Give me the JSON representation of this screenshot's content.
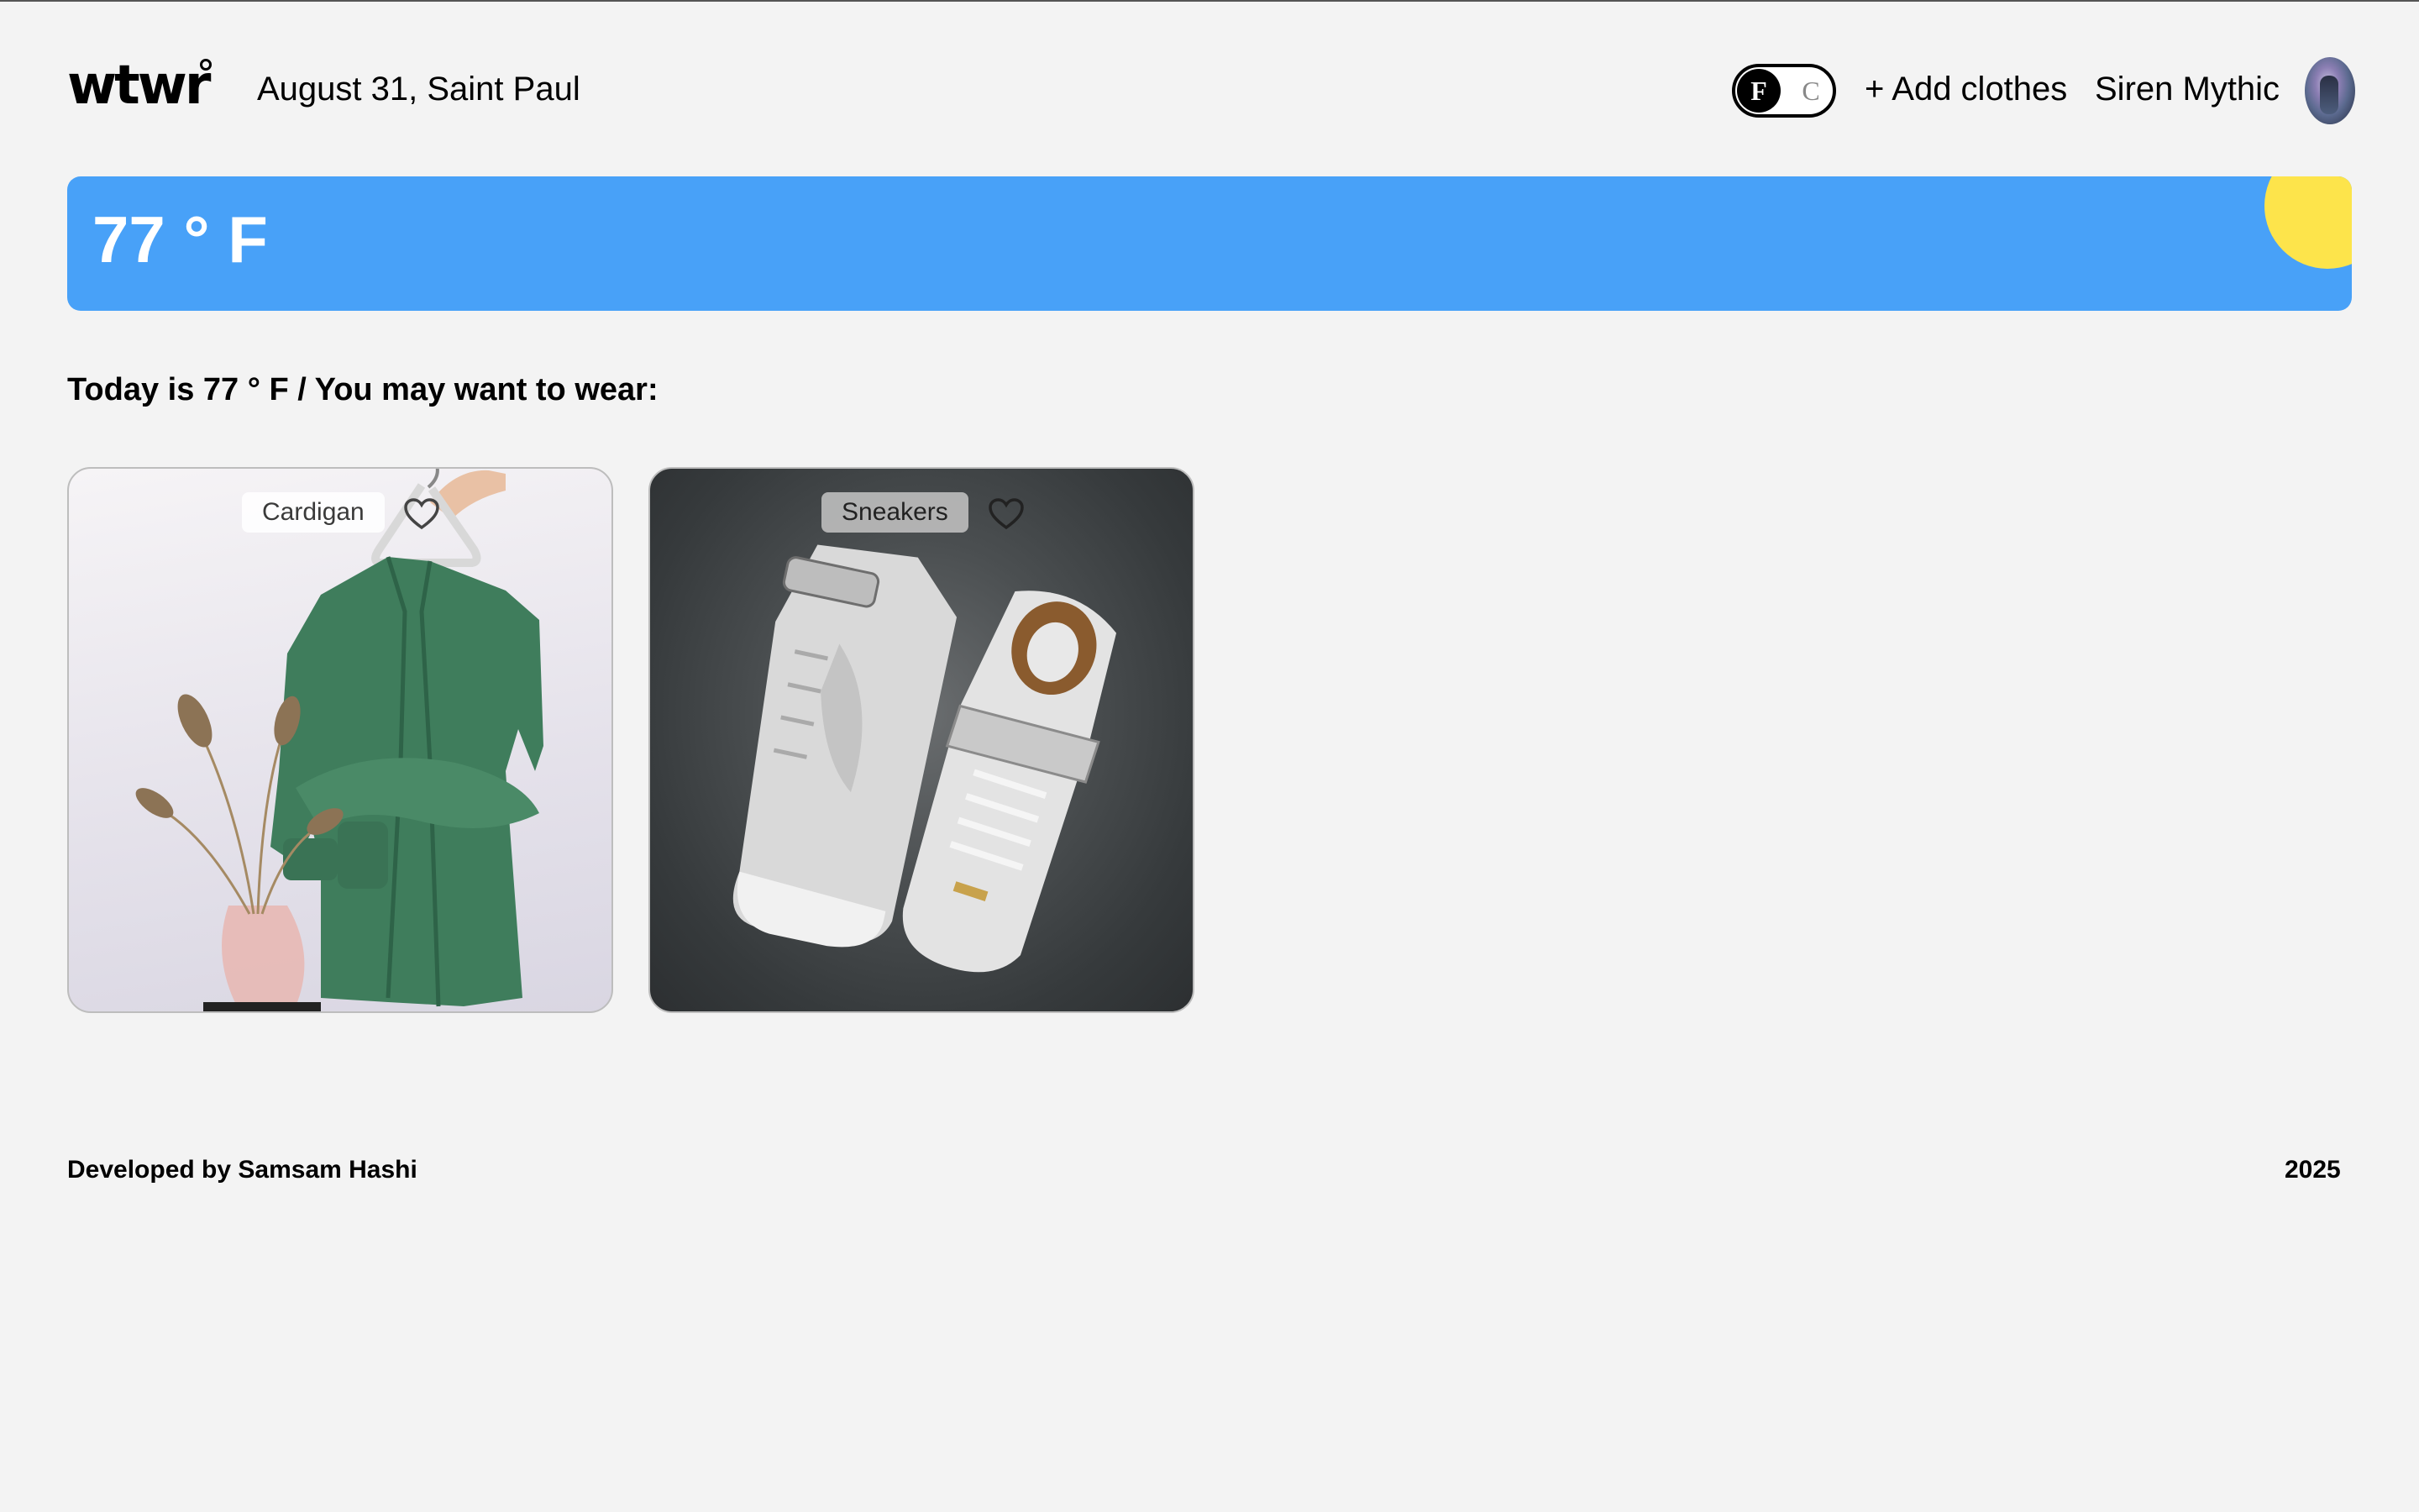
{
  "header": {
    "logo": "wtwr",
    "date_location": "August 31, Saint Paul",
    "unit_toggle": {
      "selected": "F",
      "other": "C"
    },
    "add_clothes_label": "+ Add clothes",
    "user_name": "Siren Mythic"
  },
  "weather": {
    "temperature_label": "77 ° F",
    "condition_icon": "sun-icon",
    "card_color": "#48a1f8",
    "sun_color": "#fde44b"
  },
  "recommendation": {
    "text": "Today is 77 ° F / You may want to wear:"
  },
  "items": [
    {
      "name": "Cardigan",
      "like_icon": "heart-outline-icon"
    },
    {
      "name": "Sneakers",
      "like_icon": "heart-outline-icon"
    }
  ],
  "footer": {
    "credit": "Developed by Samsam Hashi",
    "year": "2025"
  }
}
